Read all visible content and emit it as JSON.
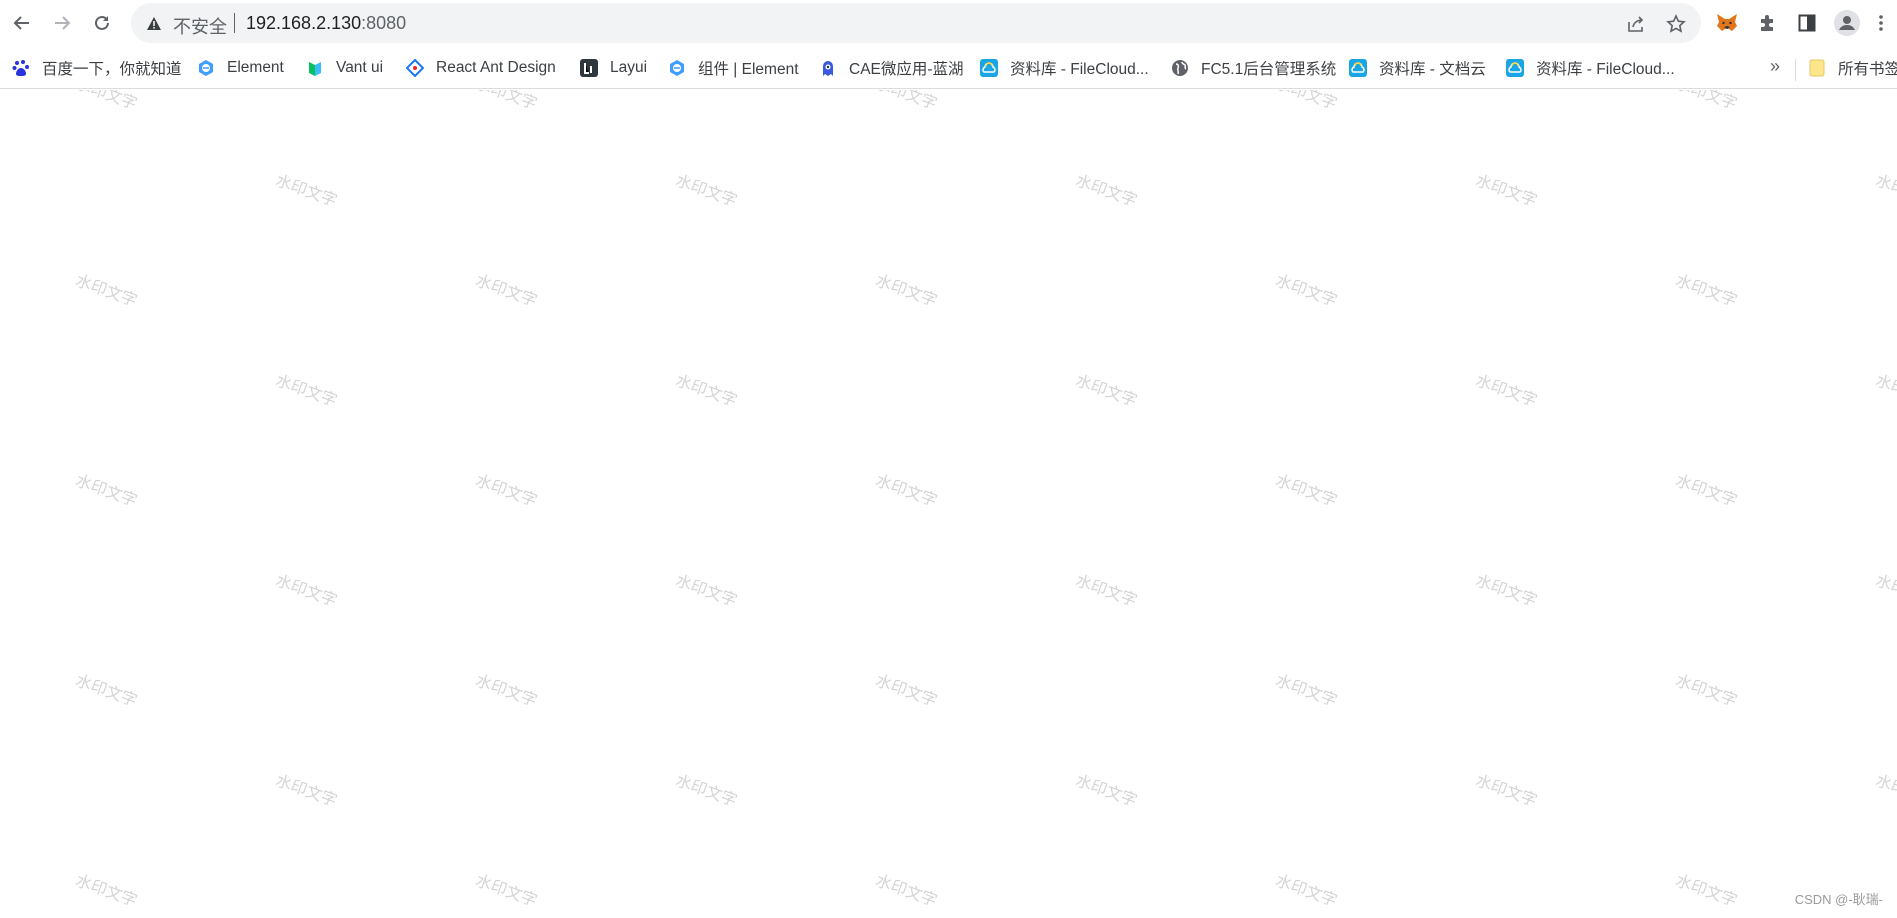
{
  "browser": {
    "address_bar": {
      "security_label": "不安全",
      "url_host": "192.168.2.130",
      "url_port": ":8080"
    },
    "nav": {
      "back_icon": "arrow-left-icon",
      "forward_icon": "arrow-right-icon",
      "reload_icon": "reload-icon"
    },
    "toolbar_icons": [
      "share-icon",
      "star-icon",
      "metamask-fox-icon",
      "extensions-puzzle-icon",
      "side-panel-icon",
      "profile-avatar-icon",
      "menu-kebab-icon"
    ]
  },
  "bookmarks": {
    "items": [
      {
        "label": "百度一下，你就知道",
        "icon": "baidu-paw-icon",
        "color": "#2932e1"
      },
      {
        "label": "Element",
        "icon": "element-icon",
        "color": "#409eff"
      },
      {
        "label": "Vant ui",
        "icon": "vant-icon",
        "color": "#07c160"
      },
      {
        "label": "React Ant Design",
        "icon": "ant-design-icon",
        "color": "#1677ff"
      },
      {
        "label": "Layui",
        "icon": "layui-icon",
        "color": "#2f363c"
      },
      {
        "label": "组件 | Element",
        "icon": "element-icon",
        "color": "#409eff"
      },
      {
        "label": "CAE微应用-蓝湖",
        "icon": "lanhu-icon",
        "color": "#3b5bdb"
      },
      {
        "label": "资料库 - FileCloud...",
        "icon": "filecloud-icon",
        "color": "#1aa6e4"
      },
      {
        "label": "FC5.1后台管理系统",
        "icon": "globe-icon",
        "color": "#5f6368"
      },
      {
        "label": "资料库 - 文档云",
        "icon": "filecloud-icon",
        "color": "#1aa6e4"
      },
      {
        "label": "资料库 - FileCloud...",
        "icon": "filecloud-icon",
        "color": "#1aa6e4"
      }
    ],
    "overflow_label": "»",
    "all_bookmarks_label": "所有书签"
  },
  "page": {
    "watermark_text": "水印文字",
    "credit": "CSDN @-耿瑞-"
  }
}
